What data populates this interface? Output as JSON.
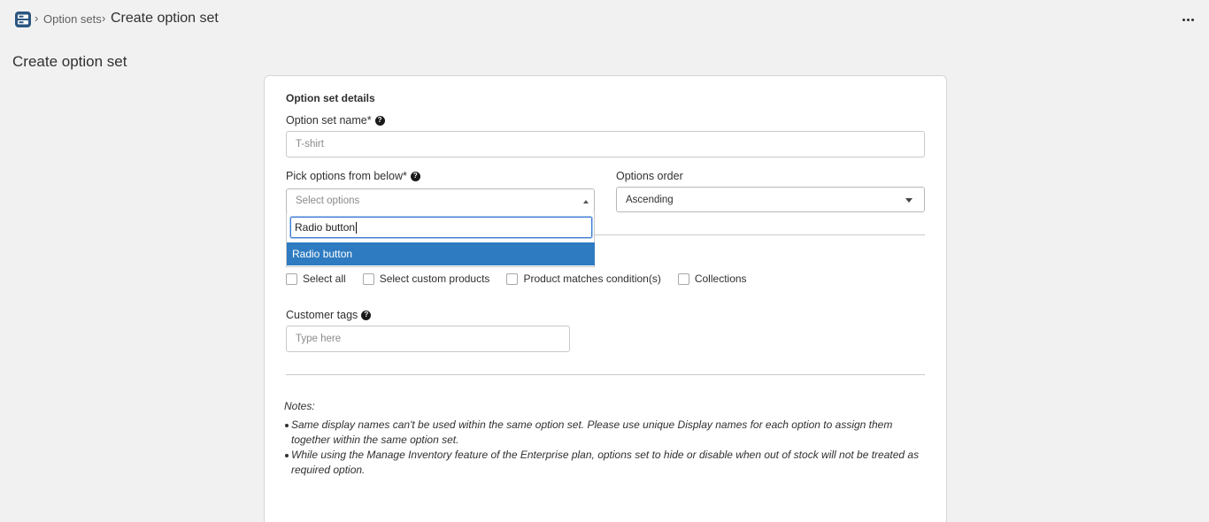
{
  "breadcrumb": {
    "app_icon": "app-logo-icon",
    "separator": "›",
    "parent_label": "Option sets",
    "current_label": "Create option set",
    "more_icon": "more-horizontal-icon"
  },
  "page": {
    "title": "Create option set"
  },
  "form": {
    "section_heading": "Option set details",
    "name_field": {
      "label": "Option set name*",
      "placeholder": "T-shirt"
    },
    "pick_options": {
      "label": "Pick options from below*",
      "placeholder": "Select options",
      "dropdown_open": true,
      "search_value": "Radio button",
      "highlighted_option": "Radio button"
    },
    "options_order": {
      "label": "Options order",
      "value": "Ascending"
    },
    "product_checkboxes": [
      {
        "label": "Select all",
        "checked": false
      },
      {
        "label": "Select custom products",
        "checked": false
      },
      {
        "label": "Product matches condition(s)",
        "checked": false
      },
      {
        "label": "Collections",
        "checked": false
      }
    ],
    "customer_tags": {
      "label": "Customer tags",
      "placeholder": "Type here"
    }
  },
  "notes": {
    "heading": "Notes:",
    "items": [
      "Same display names can't be used within the same option set. Please use unique Display names for each option to assign them together within the same option set.",
      "While using the Manage Inventory feature of the Enterprise plan, options set to hide or disable when out of stock will not be treated as required option."
    ]
  },
  "colors": {
    "page_background": "#f1f1f1",
    "highlight": "#2e7bc1",
    "focus_border": "#3d7bd5"
  }
}
